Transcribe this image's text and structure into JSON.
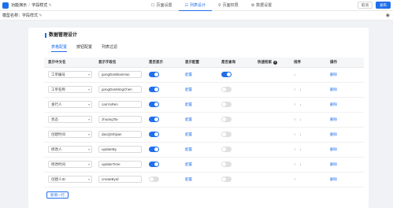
{
  "app": {
    "name": "功能演示",
    "separator": "/",
    "page": "字段样式",
    "pencil_glyph": "✎"
  },
  "nav_tabs": [
    {
      "label": "页面设置",
      "icon": "☐",
      "active": false
    },
    {
      "label": "列表设计",
      "icon": "☷",
      "active": true
    },
    {
      "label": "页面权限",
      "icon": "⚲",
      "active": false
    },
    {
      "label": "数据设置",
      "icon": "⚙",
      "active": false
    }
  ],
  "top_actions": {
    "cancel": "取消",
    "publish": "发布"
  },
  "model": {
    "label": "模型名称：",
    "value": "字段样式"
  },
  "eye_glyph": "◉",
  "section_title": "数据管理设计",
  "subtabs": [
    {
      "label": "表格配置",
      "active": true
    },
    {
      "label": "按钮配置",
      "active": false
    },
    {
      "label": "列表过滤",
      "active": false
    }
  ],
  "columns": [
    "显示中文名",
    "显示字段名",
    "是否显示",
    "显示配置",
    "是否查询",
    "快速检索",
    "排序",
    "操作"
  ],
  "help_glyph": "?",
  "caret_glyph": "▾",
  "rows": [
    {
      "display_name": "工单编号",
      "field": "gongDanBianHao",
      "show": true,
      "config": "配置",
      "query": true,
      "sort": "↓",
      "action": "删除"
    },
    {
      "display_name": "工单名称",
      "field": "gongDanMingChen",
      "show": true,
      "config": "配置",
      "query": false,
      "sort": "↑ ↓",
      "action": "删除"
    },
    {
      "display_name": "发行人",
      "field": "canYuRen",
      "show": true,
      "config": "配置",
      "query": false,
      "sort": "↑ ↓",
      "action": "删除"
    },
    {
      "display_name": "状态",
      "field": "zhuangTai",
      "show": true,
      "config": "配置",
      "query": false,
      "sort": "↑ ↓",
      "action": "删除"
    },
    {
      "display_name": "创建时间",
      "field": "daoQiShijian",
      "show": true,
      "config": "配置",
      "query": false,
      "sort": "↑ ↓",
      "action": "删除"
    },
    {
      "display_name": "修改人",
      "field": "updateBy",
      "show": true,
      "config": "配置",
      "query": false,
      "sort": "↑ ↓",
      "action": "删除"
    },
    {
      "display_name": "修改时间",
      "field": "updateTime",
      "show": true,
      "config": "配置",
      "query": false,
      "sort": "↑ ↓",
      "action": "删除"
    },
    {
      "display_name": "创建人ID",
      "field": "createById",
      "show": false,
      "config": "配置",
      "query": false,
      "sort": "↑",
      "action": "删除"
    }
  ],
  "add_button": "新增一行",
  "colors": {
    "accent": "#1f6feb"
  }
}
